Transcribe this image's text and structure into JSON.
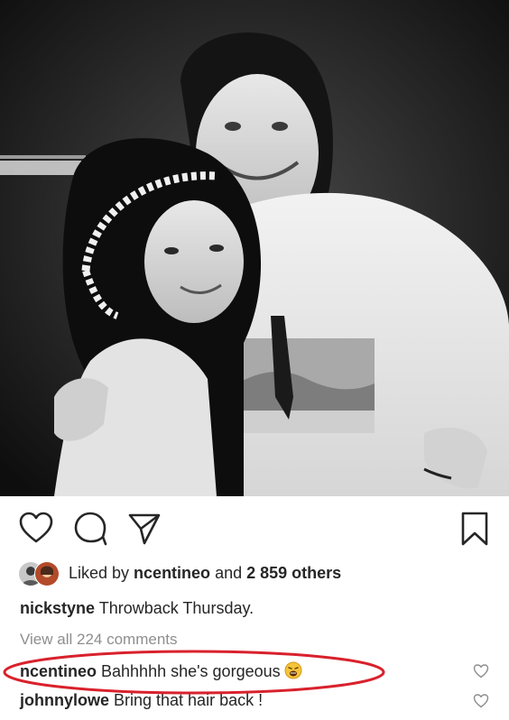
{
  "post": {
    "photo": {
      "style": "black-and-white",
      "alt_subjects": [
        "smiling-woman-with-braided-headband",
        "smiling-man-in-white-tshirt"
      ]
    },
    "actions": {
      "like_icon": "heart-outline-icon",
      "comment_icon": "comment-bubble-icon",
      "share_icon": "paper-plane-icon",
      "save_icon": "bookmark-icon"
    },
    "likes": {
      "prefix": "Liked by ",
      "user": "ncentineo",
      "connector": " and ",
      "others": "2 859 others"
    },
    "caption": {
      "username": "nickstyne",
      "text": " Throwback Thursday."
    },
    "view_all": "View all 224 comments",
    "comments": [
      {
        "username": "ncentineo",
        "text": " Bahhhhh she's gorgeous",
        "emoji": "weary-face-emoji",
        "highlighted": true
      },
      {
        "username": "johnnylowe",
        "text": " Bring that hair back !"
      }
    ],
    "colors": {
      "text": "#262626",
      "muted": "#8e8e8e",
      "highlight": "#d9212c"
    }
  }
}
